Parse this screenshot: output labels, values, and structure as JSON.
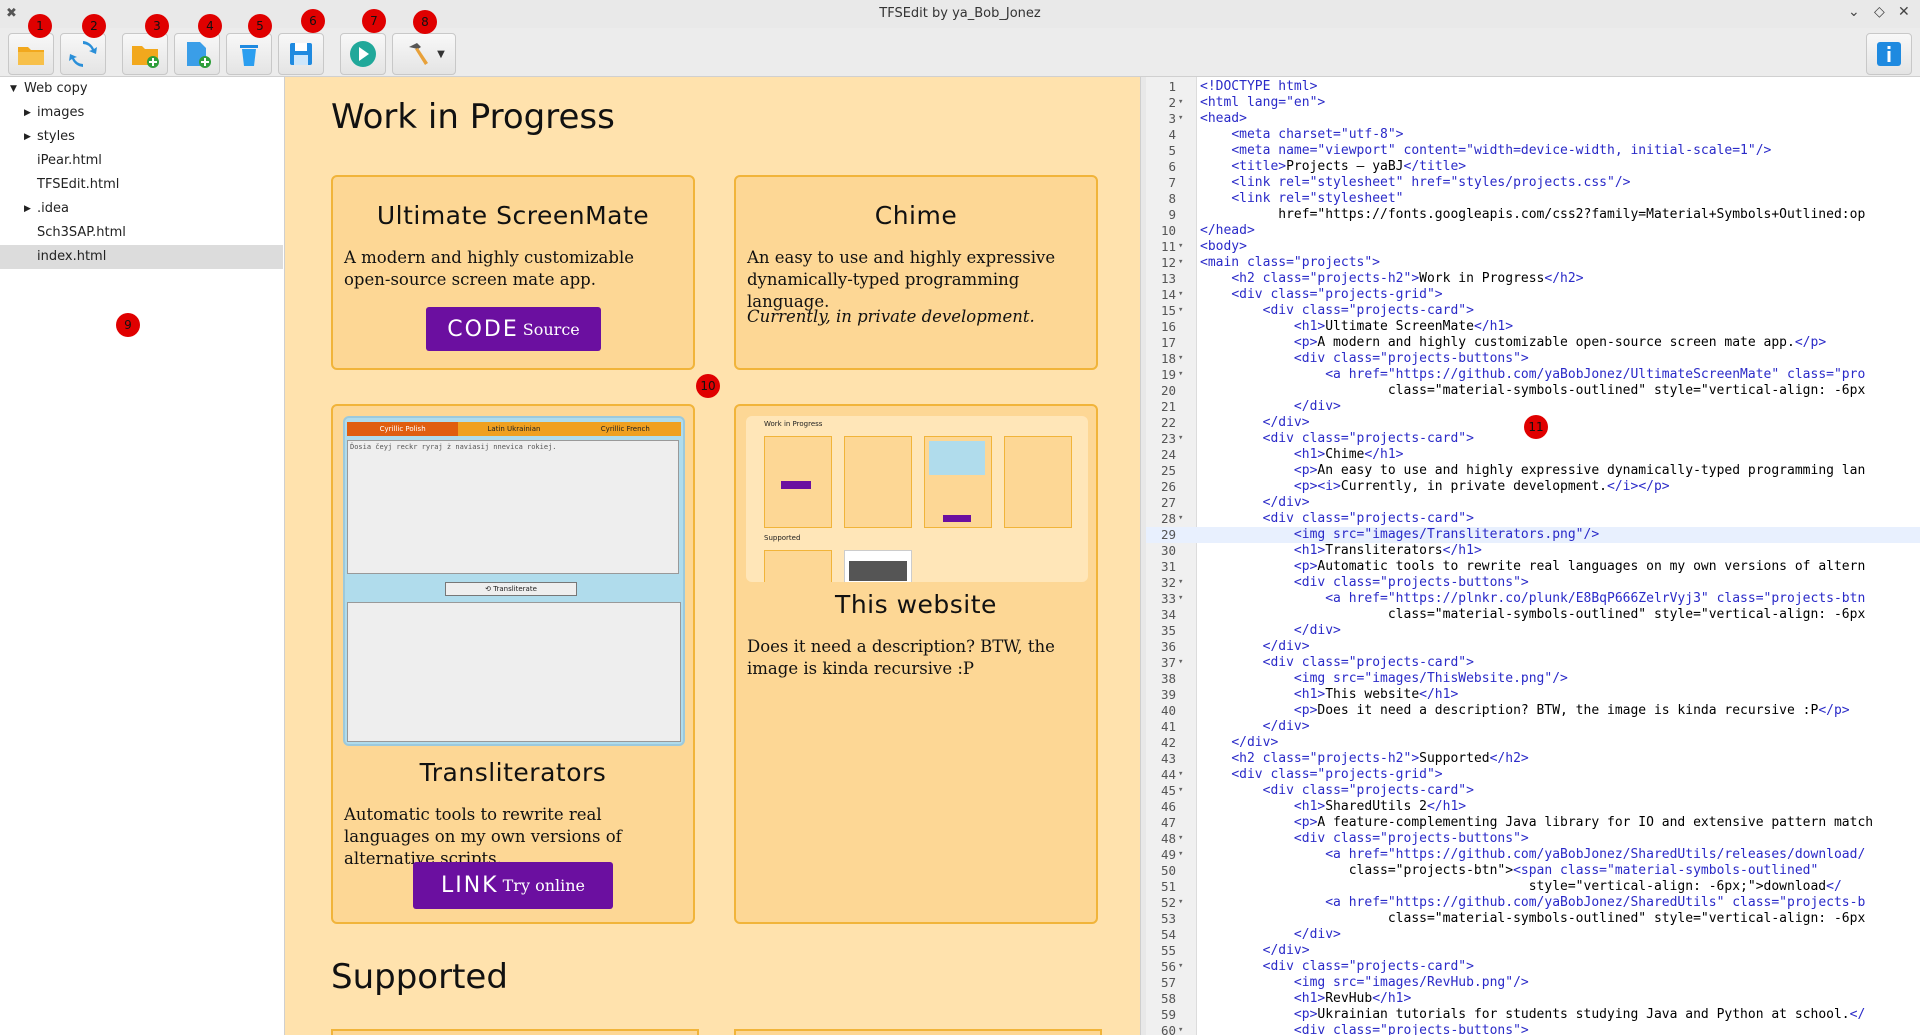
{
  "window": {
    "title": "TFSEdit by ya_Bob_Jonez",
    "controls": [
      "⌄",
      "◇",
      "✕"
    ]
  },
  "toolbar": {
    "buttons": [
      {
        "name": "open-folder",
        "badge": "1"
      },
      {
        "name": "refresh",
        "badge": "2"
      },
      {
        "name": "new-folder",
        "badge": "3"
      },
      {
        "name": "new-file",
        "badge": "4"
      },
      {
        "name": "delete",
        "badge": "5"
      },
      {
        "name": "save",
        "badge": "6"
      },
      {
        "name": "run",
        "badge": "7"
      },
      {
        "name": "build",
        "badge": "8"
      }
    ],
    "info_icon": "info-icon"
  },
  "badges": {
    "tree": "9",
    "preview": "10",
    "editor": "11"
  },
  "tree": {
    "root": "Web copy",
    "items": [
      {
        "label": "images",
        "folder": true
      },
      {
        "label": "styles",
        "folder": true
      },
      {
        "label": "iPear.html",
        "folder": false
      },
      {
        "label": "TFSEdit.html",
        "folder": false
      },
      {
        "label": ".idea",
        "folder": true
      },
      {
        "label": "Sch3SAP.html",
        "folder": false
      },
      {
        "label": "index.html",
        "folder": false,
        "selected": true
      }
    ]
  },
  "preview": {
    "heading1": "Work in Progress",
    "heading2": "Supported",
    "cards": {
      "screenmate": {
        "title": "Ultimate ScreenMate",
        "desc": "A modern and highly customizable open-source screen mate app.",
        "btn_big": "CODE",
        "btn_small": "Source"
      },
      "chime": {
        "title": "Chime",
        "desc": "An easy to use and highly expressive dynamically-typed programming language.",
        "note": "Currently, in private development."
      },
      "transliterators": {
        "title": "Transliterators",
        "desc": "Automatic tools to rewrite real languages on my own versions of alternative scripts.",
        "btn_big": "LINK",
        "btn_small": "Try online",
        "tabs": [
          "Cyrillic Polish",
          "Latin Ukrainian",
          "Cyrillic French"
        ],
        "input_text": "Ďosia čeyj reckr ryraj ż naviasij nnevica rokiej.",
        "action": "⟲ Transliterate"
      },
      "website": {
        "title": "This website",
        "desc": "Does it need a description? BTW, the image is kinda recursive :P",
        "thumb_heading1": "Work in Progress",
        "thumb_heading2": "Supported"
      }
    }
  },
  "editor": {
    "current_line": 29,
    "lines": [
      {
        "n": 1,
        "fold": false,
        "text": "<!DOCTYPE html>"
      },
      {
        "n": 2,
        "fold": true,
        "text": "<html lang=\"en\">"
      },
      {
        "n": 3,
        "fold": true,
        "text": "<head>"
      },
      {
        "n": 4,
        "fold": false,
        "text": "    <meta charset=\"utf-8\">"
      },
      {
        "n": 5,
        "fold": false,
        "text": "    <meta name=\"viewport\" content=\"width=device-width, initial-scale=1\"/>"
      },
      {
        "n": 6,
        "fold": false,
        "text": "    <title>Projects — yaBJ</title>"
      },
      {
        "n": 7,
        "fold": false,
        "text": "    <link rel=\"stylesheet\" href=\"styles/projects.css\"/>"
      },
      {
        "n": 8,
        "fold": false,
        "text": "    <link rel=\"stylesheet\""
      },
      {
        "n": 9,
        "fold": false,
        "text": "          href=\"https://fonts.googleapis.com/css2?family=Material+Symbols+Outlined:op"
      },
      {
        "n": 10,
        "fold": false,
        "text": "</head>"
      },
      {
        "n": 11,
        "fold": true,
        "text": "<body>"
      },
      {
        "n": 12,
        "fold": true,
        "text": "<main class=\"projects\">"
      },
      {
        "n": 13,
        "fold": false,
        "text": "    <h2 class=\"projects-h2\">Work in Progress</h2>"
      },
      {
        "n": 14,
        "fold": true,
        "text": "    <div class=\"projects-grid\">"
      },
      {
        "n": 15,
        "fold": true,
        "text": "        <div class=\"projects-card\">"
      },
      {
        "n": 16,
        "fold": false,
        "text": "            <h1>Ultimate ScreenMate</h1>"
      },
      {
        "n": 17,
        "fold": false,
        "text": "            <p>A modern and highly customizable open-source screen mate app.</p>"
      },
      {
        "n": 18,
        "fold": true,
        "text": "            <div class=\"projects-buttons\">"
      },
      {
        "n": 19,
        "fold": true,
        "text": "                <a href=\"https://github.com/yaBobJonez/UltimateScreenMate\" class=\"pro"
      },
      {
        "n": 20,
        "fold": false,
        "text": "                        class=\"material-symbols-outlined\" style=\"vertical-align: -6px"
      },
      {
        "n": 21,
        "fold": false,
        "text": "            </div>"
      },
      {
        "n": 22,
        "fold": false,
        "text": "        </div>"
      },
      {
        "n": 23,
        "fold": true,
        "text": "        <div class=\"projects-card\">"
      },
      {
        "n": 24,
        "fold": false,
        "text": "            <h1>Chime</h1>"
      },
      {
        "n": 25,
        "fold": false,
        "text": "            <p>An easy to use and highly expressive dynamically-typed programming lan"
      },
      {
        "n": 26,
        "fold": false,
        "text": "            <p><i>Currently, in private development.</i></p>"
      },
      {
        "n": 27,
        "fold": false,
        "text": "        </div>"
      },
      {
        "n": 28,
        "fold": true,
        "text": "        <div class=\"projects-card\">"
      },
      {
        "n": 29,
        "fold": false,
        "text": "            <img src=\"images/Transliterators.png\"/>"
      },
      {
        "n": 30,
        "fold": false,
        "text": "            <h1>Transliterators</h1>"
      },
      {
        "n": 31,
        "fold": false,
        "text": "            <p>Automatic tools to rewrite real languages on my own versions of altern"
      },
      {
        "n": 32,
        "fold": true,
        "text": "            <div class=\"projects-buttons\">"
      },
      {
        "n": 33,
        "fold": true,
        "text": "                <a href=\"https://plnkr.co/plunk/E8BqP666ZelrVyj3\" class=\"projects-btn"
      },
      {
        "n": 34,
        "fold": false,
        "text": "                        class=\"material-symbols-outlined\" style=\"vertical-align: -6px"
      },
      {
        "n": 35,
        "fold": false,
        "text": "            </div>"
      },
      {
        "n": 36,
        "fold": false,
        "text": "        </div>"
      },
      {
        "n": 37,
        "fold": true,
        "text": "        <div class=\"projects-card\">"
      },
      {
        "n": 38,
        "fold": false,
        "text": "            <img src=\"images/ThisWebsite.png\"/>"
      },
      {
        "n": 39,
        "fold": false,
        "text": "            <h1>This website</h1>"
      },
      {
        "n": 40,
        "fold": false,
        "text": "            <p>Does it need a description? BTW, the image is kinda recursive :P</p>"
      },
      {
        "n": 41,
        "fold": false,
        "text": "        </div>"
      },
      {
        "n": 42,
        "fold": false,
        "text": "    </div>"
      },
      {
        "n": 43,
        "fold": false,
        "text": "    <h2 class=\"projects-h2\">Supported</h2>"
      },
      {
        "n": 44,
        "fold": true,
        "text": "    <div class=\"projects-grid\">"
      },
      {
        "n": 45,
        "fold": true,
        "text": "        <div class=\"projects-card\">"
      },
      {
        "n": 46,
        "fold": false,
        "text": "            <h1>SharedUtils 2</h1>"
      },
      {
        "n": 47,
        "fold": false,
        "text": "            <p>A feature-complementing Java library for IO and extensive pattern match"
      },
      {
        "n": 48,
        "fold": true,
        "text": "            <div class=\"projects-buttons\">"
      },
      {
        "n": 49,
        "fold": true,
        "text": "                <a href=\"https://github.com/yaBobJonez/SharedUtils/releases/download/"
      },
      {
        "n": 50,
        "fold": false,
        "text": "                   class=\"projects-btn\"><span class=\"material-symbols-outlined\""
      },
      {
        "n": 51,
        "fold": false,
        "text": "                                          style=\"vertical-align: -6px;\">download</"
      },
      {
        "n": 52,
        "fold": true,
        "text": "                <a href=\"https://github.com/yaBobJonez/SharedUtils\" class=\"projects-b"
      },
      {
        "n": 53,
        "fold": false,
        "text": "                        class=\"material-symbols-outlined\" style=\"vertical-align: -6px"
      },
      {
        "n": 54,
        "fold": false,
        "text": "            </div>"
      },
      {
        "n": 55,
        "fold": false,
        "text": "        </div>"
      },
      {
        "n": 56,
        "fold": true,
        "text": "        <div class=\"projects-card\">"
      },
      {
        "n": 57,
        "fold": false,
        "text": "            <img src=\"images/RevHub.png\"/>"
      },
      {
        "n": 58,
        "fold": false,
        "text": "            <h1>RevHub</h1>"
      },
      {
        "n": 59,
        "fold": false,
        "text": "            <p>Ukrainian tutorials for students studying Java and Python at school.</"
      },
      {
        "n": 60,
        "fold": true,
        "text": "            <div class=\"projects-buttons\">"
      }
    ]
  }
}
